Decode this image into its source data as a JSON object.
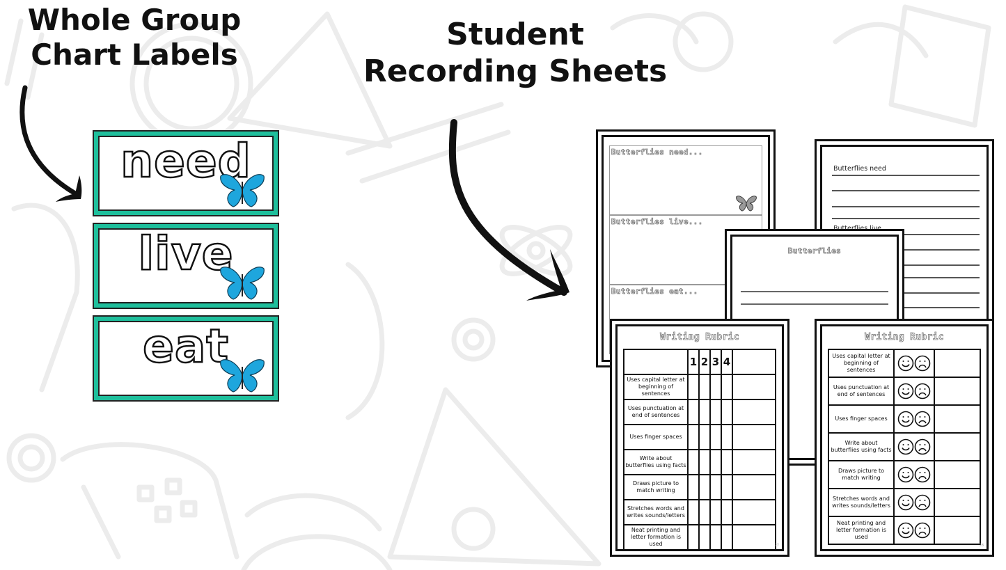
{
  "headings": {
    "left": "Whole Group Chart Labels",
    "left_lines": [
      "Whole Group",
      "Chart Labels"
    ],
    "right_lines": [
      "Student",
      "Recording Sheets"
    ]
  },
  "colors": {
    "card_border": "#1fbf9c",
    "butterfly_blue": "#1ea6dd",
    "background_pattern": "#ececec",
    "text": "#111111"
  },
  "chart_labels": [
    {
      "word": "need",
      "icon": "butterfly-icon"
    },
    {
      "word": "live",
      "icon": "butterfly-icon"
    },
    {
      "word": "eat",
      "icon": "butterfly-icon"
    }
  ],
  "sheets": {
    "boxes_sheet": {
      "prompts": [
        "Butterflies need...",
        "Butterflies live...",
        "Butterflies eat..."
      ],
      "icon": "butterfly-icon"
    },
    "lines_sheet": {
      "prompts": [
        "Butterflies need",
        "Butterflies live"
      ]
    },
    "title_sheet": {
      "title": "Butterflies"
    },
    "rubric_numbers": {
      "title": "Writing Rubric",
      "scores": [
        "1",
        "2",
        "3",
        "4"
      ],
      "criteria": [
        "Uses capital letter at beginning of sentences",
        "Uses punctuation at end of sentences",
        "Uses finger spaces",
        "Write about butterflies using facts",
        "Draws picture to match writing",
        "Stretches words and writes sounds/letters",
        "Neat printing and letter formation is used"
      ],
      "page": "27"
    },
    "rubric_faces": {
      "title": "Writing Rubric",
      "faces": [
        "smiley-face-icon",
        "frowny-face-icon"
      ],
      "criteria": [
        "Uses capital letter at beginning of sentences",
        "Uses punctuation at end of sentences",
        "Uses finger spaces",
        "Write about butterflies using facts",
        "Draws picture to match writing",
        "Stretches words and writes sounds/letters",
        "Neat printing and letter formation is used"
      ],
      "page": "28"
    }
  }
}
